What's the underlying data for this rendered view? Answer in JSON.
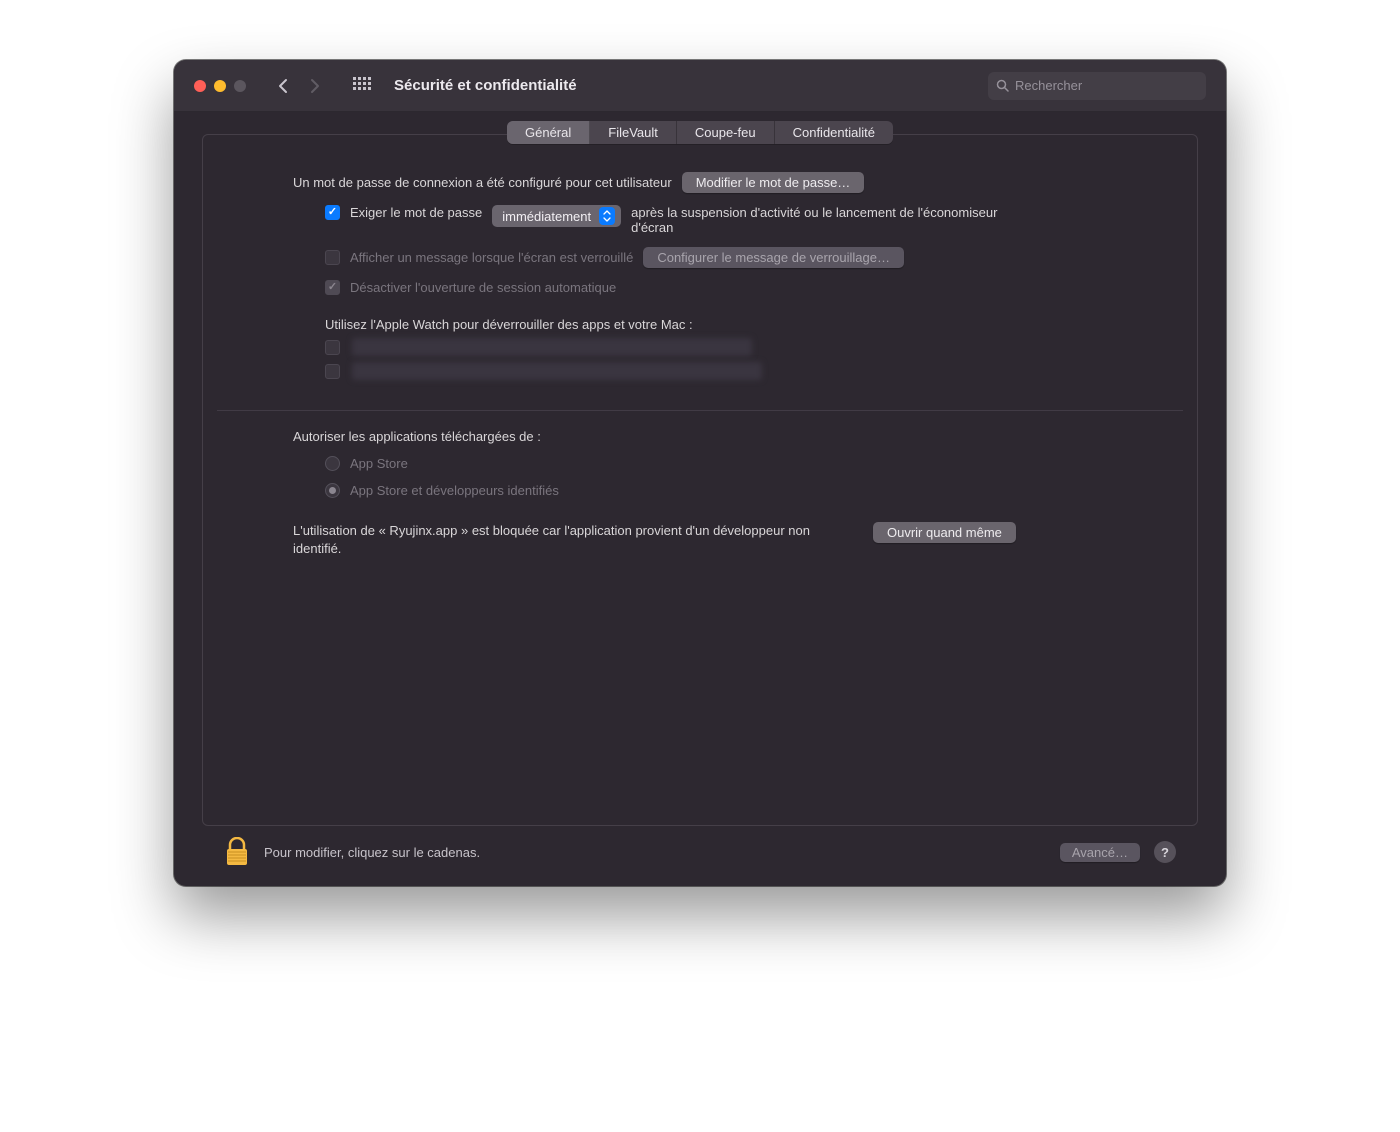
{
  "titlebar": {
    "title": "Sécurité et confidentialité",
    "search_placeholder": "Rechercher"
  },
  "tabs": {
    "general": "Général",
    "filevault": "FileVault",
    "firewall": "Coupe-feu",
    "privacy": "Confidentialité"
  },
  "general": {
    "password_set_label": "Un mot de passe de connexion a été configuré pour cet utilisateur",
    "change_password_btn": "Modifier le mot de passe…",
    "require_pw_prefix": "Exiger le mot de passe",
    "require_pw_delay": "immédiatement",
    "require_pw_suffix": "après la suspension d'activité ou le lancement de l'économiseur d'écran",
    "show_lock_msg_label": "Afficher un message lorsque l'écran est verrouillé",
    "configure_lock_msg_btn": "Configurer le message de verrouillage…",
    "disable_auto_login_label": "Désactiver l'ouverture de session automatique",
    "apple_watch_label": "Utilisez l'Apple Watch pour déverrouiller des apps et votre Mac :"
  },
  "allow_apps": {
    "heading": "Autoriser les applications téléchargées de :",
    "option_appstore": "App Store",
    "option_identified": "App Store et développeurs identifiés",
    "blocked_text": "L'utilisation de « Ryujinx.app » est bloquée car l'application provient d'un développeur non identifié.",
    "open_anyway_btn": "Ouvrir quand même"
  },
  "footer": {
    "lock_text": "Pour modifier, cliquez sur le cadenas.",
    "advanced_btn": "Avancé…",
    "help": "?"
  }
}
